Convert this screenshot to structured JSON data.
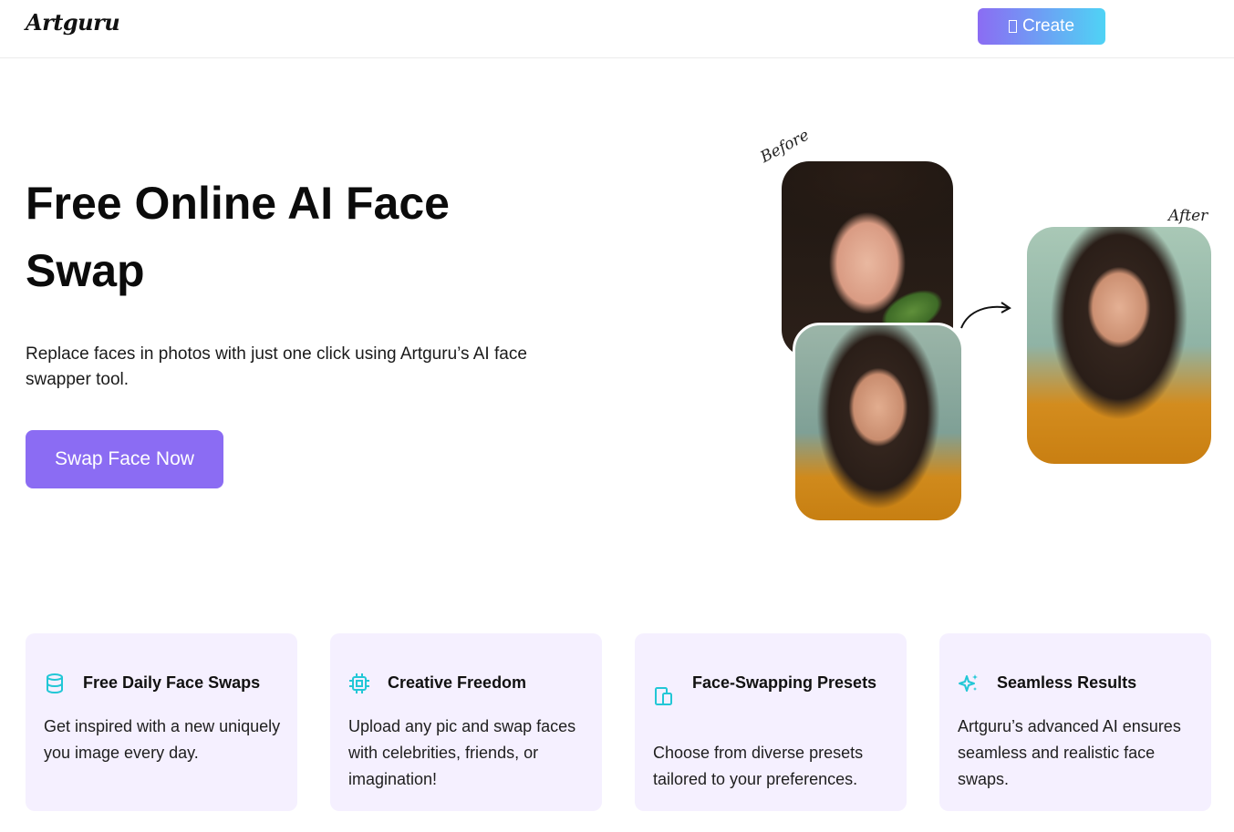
{
  "header": {
    "logo": "Artguru",
    "create_label": "Create"
  },
  "hero": {
    "title": "Free Online AI Face Swap",
    "subtitle": "Replace faces in photos with just one click using Artguru’s AI face swapper tool.",
    "cta_label": "Swap Face Now",
    "before_label": "Before",
    "after_label": "After"
  },
  "features": [
    {
      "icon": "database-icon",
      "title": "Free Daily Face Swaps",
      "desc": "Get inspired with a new uniquely you image every day."
    },
    {
      "icon": "chip-icon",
      "title": "Creative Freedom",
      "desc": "Upload any pic and swap faces with celebrities, friends, or imagination!"
    },
    {
      "icon": "devices-icon",
      "title": "Face-Swapping Presets",
      "desc": "Choose from diverse presets tailored to your preferences."
    },
    {
      "icon": "sparkles-icon",
      "title": "Seamless Results",
      "desc": "Artguru’s advanced AI ensures seamless and realistic face swaps."
    }
  ],
  "colors": {
    "accent": "#8b6cf3",
    "gradient_end": "#4fd3f5",
    "icon_teal": "#22c7d6",
    "card_bg": "#f5f0ff"
  }
}
